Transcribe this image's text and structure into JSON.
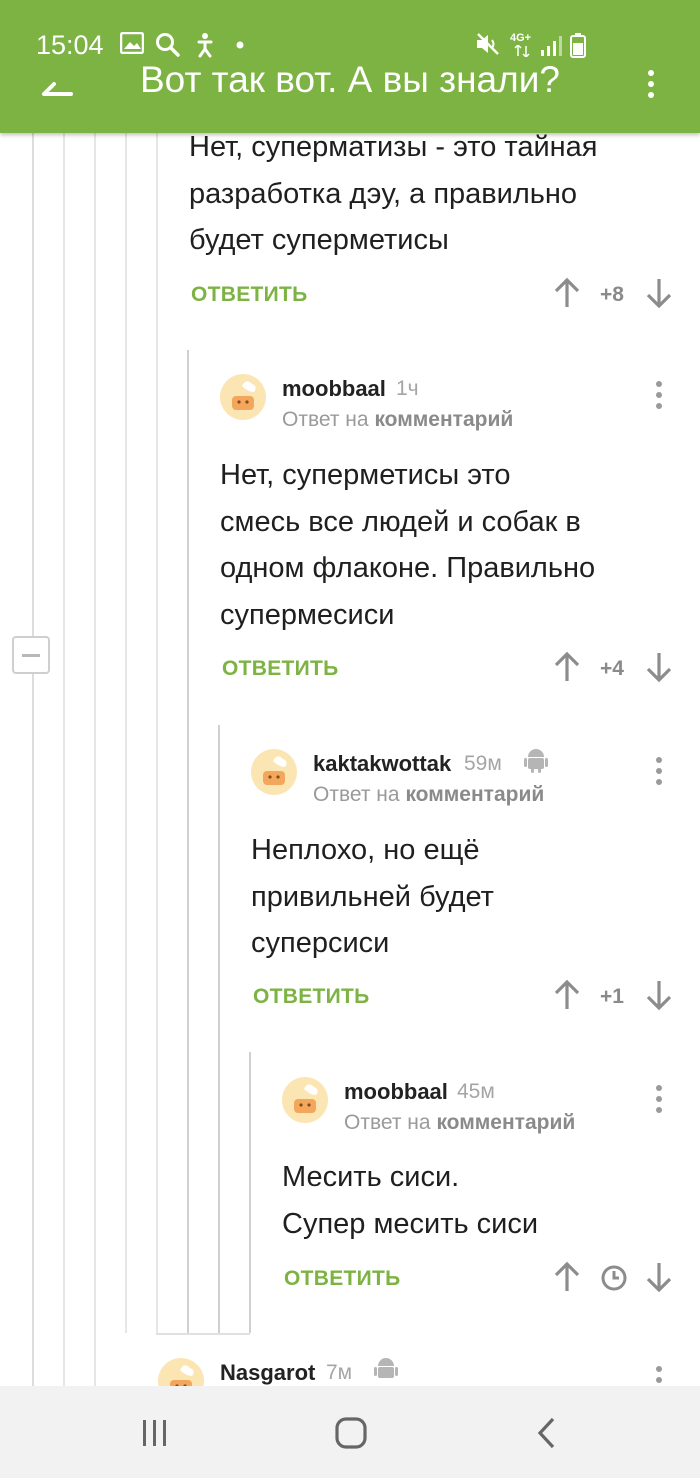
{
  "status_bar": {
    "time": "15:04",
    "network": "4G+"
  },
  "app_bar": {
    "title": "Вот так вот. А вы знали?"
  },
  "comments": [
    {
      "text_lines": [
        "Нет, суперматизы - это тайная",
        "разработка дэу, а правильно",
        "будет суперметисы"
      ],
      "reply_label": "ОТВЕТИТЬ",
      "score": "+8"
    },
    {
      "author": "moobbaal",
      "ago": "1ч",
      "reply_prefix": "Ответ на",
      "reply_target": "комментарий",
      "text_lines": [
        "Нет, суперметисы это",
        "смесь все людей и собак в",
        "одном флаконе. Правильно",
        "супермесиси"
      ],
      "reply_label": "ОТВЕТИТЬ",
      "score": "+4"
    },
    {
      "author": "kaktakwottak",
      "ago": "59м",
      "reply_prefix": "Ответ на",
      "reply_target": "комментарий",
      "text_lines": [
        "Неплохо, но ещё",
        "привильней будет",
        "суперсиси"
      ],
      "reply_label": "ОТВЕТИТЬ",
      "score": "+1"
    },
    {
      "author": "moobbaal",
      "ago": "45м",
      "reply_prefix": "Ответ на",
      "reply_target": "комментарий",
      "text_lines": [
        "Месить сиси.",
        "Супер месить сиси"
      ],
      "reply_label": "ОТВЕТИТЬ"
    },
    {
      "author": "Nasgarot",
      "ago": "7м"
    }
  ],
  "icons": {
    "upvote": "arrow-up-icon",
    "downvote": "arrow-down-icon",
    "pending": "clock-icon",
    "android": "android-icon",
    "menu": "more-vertical-icon"
  },
  "colors": {
    "accent": "#7cb342",
    "text": "#1f1f1f",
    "muted": "#9a9a9a"
  }
}
